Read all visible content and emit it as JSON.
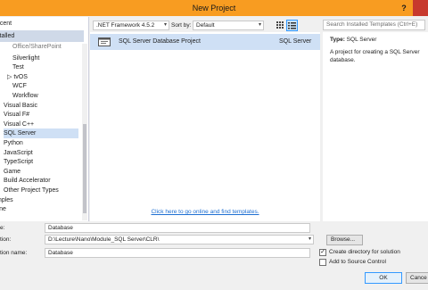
{
  "window": {
    "title": "New Project",
    "help_label": "?"
  },
  "tree": {
    "recent_label": "ecent",
    "installed_label": "stalled",
    "items": [
      {
        "label": "Office/SharePoint",
        "indent": 2
      },
      {
        "label": "Silverlight",
        "indent": 2
      },
      {
        "label": "Test",
        "indent": 2
      },
      {
        "label": "▷ tvOS",
        "indent": 1
      },
      {
        "label": "WCF",
        "indent": 2
      },
      {
        "label": "Workflow",
        "indent": 2
      },
      {
        "label": "Visual Basic",
        "indent": 0
      },
      {
        "label": "Visual F#",
        "indent": 0
      },
      {
        "label": "Visual C++",
        "indent": 0
      },
      {
        "label": "SQL Server",
        "indent": 0,
        "selected": true
      },
      {
        "label": "Python",
        "indent": 0
      },
      {
        "label": "JavaScript",
        "indent": 0
      },
      {
        "label": "TypeScript",
        "indent": 0
      },
      {
        "label": "Game",
        "indent": 0
      },
      {
        "label": "Build Accelerator",
        "indent": 0
      },
      {
        "label": "Other Project Types",
        "indent": 0
      },
      {
        "label": "mples",
        "indent": -1
      },
      {
        "label": "line",
        "indent": -1
      }
    ]
  },
  "toolbar": {
    "framework": ".NET Framework 4.5.2",
    "sort_label": "Sort by:",
    "sort_value": "Default",
    "search_placeholder": "Search Installed Templates (Ctrl+E)"
  },
  "templates": [
    {
      "name": "SQL Server Database Project",
      "language": "SQL Server",
      "icon": "database-project-icon"
    }
  ],
  "online_link": "Click here to go online and find templates.",
  "description": {
    "type_label": "Type:",
    "type_value": "SQL Server",
    "text": "A project for creating a SQL Server database."
  },
  "form": {
    "name_label": "e:",
    "name_value": "Database",
    "location_label": "tion:",
    "location_value": "D:\\Lecture\\Nano\\Module_SQL Server\\CLR\\",
    "solution_label": "tion name:",
    "solution_value": "Database",
    "browse_label": "Browse...",
    "create_dir_label": "Create directory for solution",
    "create_dir_checked": true,
    "source_control_label": "Add to Source Control",
    "source_control_checked": false,
    "ok_label": "OK",
    "cancel_label": "Cance"
  },
  "colors": {
    "titlebar": "#f89c21",
    "close": "#c7392d",
    "selection": "#cfe0f5",
    "link": "#1e6fd2"
  }
}
